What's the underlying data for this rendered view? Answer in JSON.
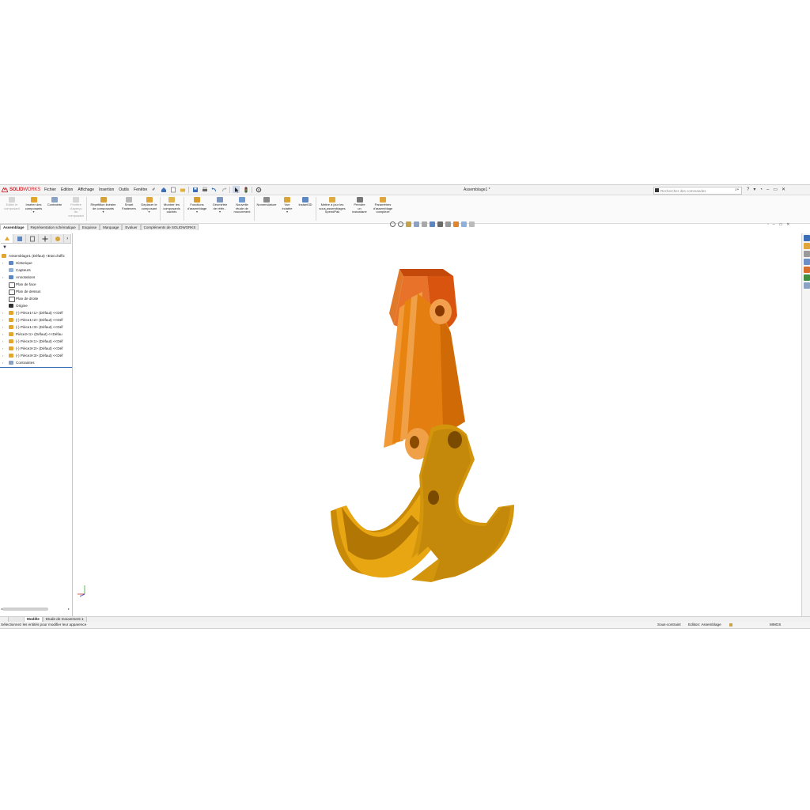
{
  "app": {
    "logo_brand": "SOLID",
    "logo_brand2": "WORKS",
    "document_title": "Assemblage1 *"
  },
  "menu": [
    "Fichier",
    "Edition",
    "Affichage",
    "Insertion",
    "Outils",
    "Fenêtre"
  ],
  "search": {
    "placeholder": "Rechercher des commandes"
  },
  "commands": [
    {
      "label": "Editer le\ncomposant",
      "disabled": true
    },
    {
      "label": "Insérer des\ncomposants",
      "disabled": false
    },
    {
      "label": "Contrainte",
      "disabled": false
    },
    {
      "label": "Fenêtre\nd'aperçu\ndu\ncomposant",
      "disabled": true
    },
    {
      "label": "Répétition linéaire\nde composants",
      "disabled": false
    },
    {
      "label": "Smart\nFasteners",
      "disabled": false
    },
    {
      "label": "Déplacer le\ncomposant",
      "disabled": false
    },
    {
      "label": "Montrer les\ncomposants\ncachés",
      "disabled": false
    },
    {
      "label": "Fonctions\nd'assemblage",
      "disabled": false
    },
    {
      "label": "Géométrie\nde référ...",
      "disabled": false
    },
    {
      "label": "Nouvelle\nétude de\nmouvement",
      "disabled": false
    },
    {
      "label": "Nomenclature",
      "disabled": false
    },
    {
      "label": "Vue\néclatée",
      "disabled": false
    },
    {
      "label": "Instant3D",
      "disabled": false
    },
    {
      "label": "Mettre à jour les\nsous-assemblages\nSpeedPak",
      "disabled": false
    },
    {
      "label": "Prendre\nun\ninstantané",
      "disabled": false
    },
    {
      "label": "Paramètres\nd'assemblage\ncomplexe",
      "disabled": false
    }
  ],
  "tabs": [
    "Assemblage",
    "Représentation schématique",
    "Esquisse",
    "Marquage",
    "Evaluer",
    "Compléments de SOLIDWORKS"
  ],
  "active_tab": "Assemblage",
  "tree": [
    {
      "label": "Assemblage1 (Défaut) <Etat d'affic",
      "icon": "assembly-icon",
      "expandable": false,
      "indent": 0
    },
    {
      "label": "Historique",
      "icon": "history-icon",
      "expandable": true,
      "indent": 1
    },
    {
      "label": "Capteurs",
      "icon": "sensor-icon",
      "expandable": false,
      "indent": 1
    },
    {
      "label": "Annotations",
      "icon": "annotation-icon",
      "expandable": true,
      "indent": 1
    },
    {
      "label": "Plan de face",
      "icon": "plane-icon",
      "expandable": false,
      "indent": 1
    },
    {
      "label": "Plan de dessus",
      "icon": "plane-icon",
      "expandable": false,
      "indent": 1
    },
    {
      "label": "Plan de droite",
      "icon": "plane-icon",
      "expandable": false,
      "indent": 1
    },
    {
      "label": "Origine",
      "icon": "origin-icon",
      "expandable": false,
      "indent": 1
    },
    {
      "label": "(-) Pièce1<1> (Défaut) <<Déf",
      "icon": "part-icon",
      "expandable": true,
      "indent": 1
    },
    {
      "label": "(-) Pièce1<2> (Défaut) <<Déf",
      "icon": "part-icon",
      "expandable": true,
      "indent": 1
    },
    {
      "label": "(-) Pièce1<3> (Défaut) <<Déf",
      "icon": "part-icon",
      "expandable": true,
      "indent": 1
    },
    {
      "label": "Pièce2<1> (Défaut) <<Défau",
      "icon": "part-icon",
      "expandable": true,
      "indent": 1
    },
    {
      "label": "(-) Pièce3<1> (Défaut) <<Déf",
      "icon": "part-icon",
      "expandable": true,
      "indent": 1
    },
    {
      "label": "(-) Pièce3<2> (Défaut) <<Déf",
      "icon": "part-icon",
      "expandable": true,
      "indent": 1
    },
    {
      "label": "(-) Pièce3<3> (Défaut) <<Déf",
      "icon": "part-icon",
      "expandable": true,
      "indent": 1
    },
    {
      "label": "Contraintes",
      "icon": "mates-icon",
      "expandable": true,
      "indent": 1
    }
  ],
  "bottom_tabs": [
    "",
    "Modèle",
    "Etude de mouvement 1"
  ],
  "status": {
    "message": "Sélectionnez les entités pour modifier leur apparence",
    "constraint": "Sous-contraint",
    "mode": "Edition: Assemblage",
    "units": "MMGS"
  },
  "colors": {
    "accent": "#d0262d",
    "model_top_link": "#d9550f",
    "model_arm": "#e8830f",
    "model_jaw": "#d9920c"
  }
}
